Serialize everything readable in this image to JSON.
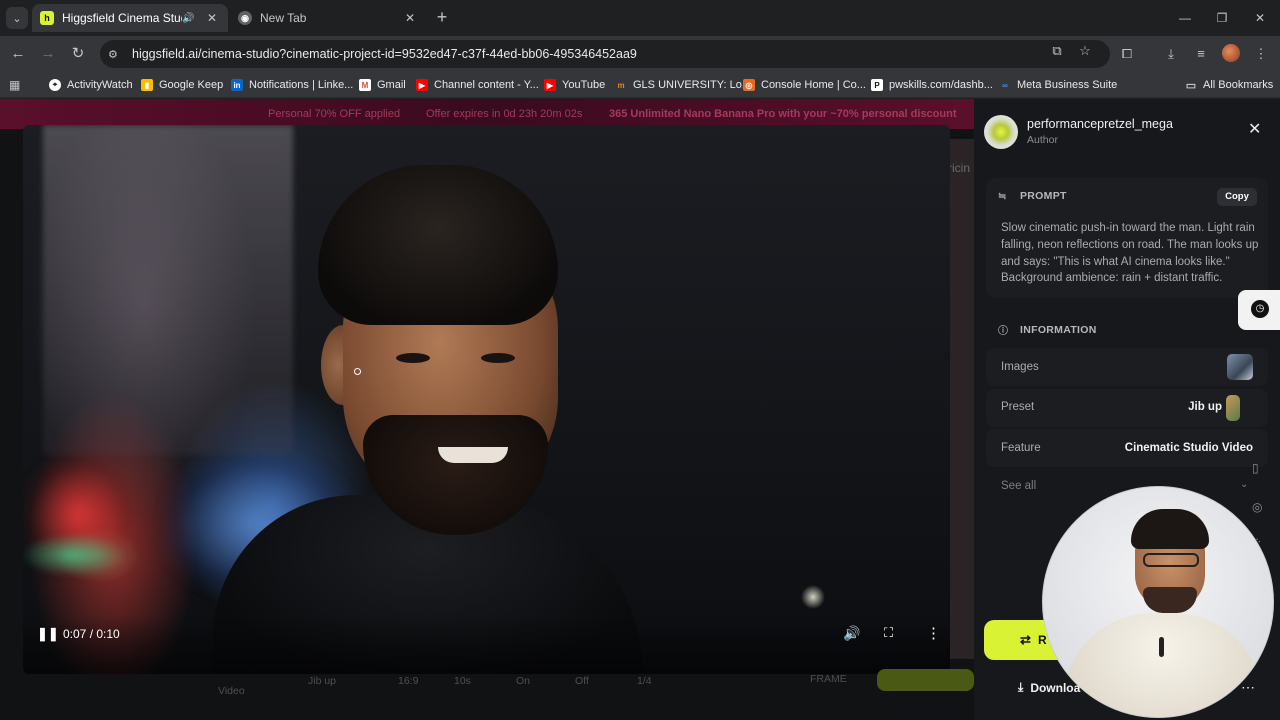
{
  "browser": {
    "tabs": [
      {
        "title": "Higgsfield Cinema Studio | ",
        "active": true
      },
      {
        "title": "New Tab",
        "active": false
      }
    ],
    "url": "higgsfield.ai/cinema-studio?cinematic-project-id=9532ed47-c37f-44ed-bb06-495346452aa9",
    "bookmarks": [
      "ActivityWatch",
      "Google Keep",
      "Notifications | Linke...",
      "Gmail",
      "Channel content - Y...",
      "YouTube",
      "GLS UNIVERSITY: Lo...",
      "Console Home | Co...",
      "pwskills.com/dashb...",
      "Meta Business Suite"
    ],
    "all_bookmarks_label": "All Bookmarks"
  },
  "promo": {
    "left": "Personal 70% OFF applied",
    "middle": "Offer expires in 0d 23h 20m 02s",
    "right": "365 Unlimited Nano Banana Pro with your ~70% personal discount"
  },
  "background": {
    "pricing_fragment": "ricin"
  },
  "video": {
    "time": "0:07 / 0:10",
    "progress": 0.75
  },
  "composer": {
    "video_label": "Video",
    "preset": "Jib up",
    "aspect": "16:9",
    "duration": "10s",
    "sound": "On",
    "other": "Off",
    "count": "1/4",
    "frame": "FRAME"
  },
  "panel": {
    "author_name": "performancepretzel_mega",
    "author_role": "Author",
    "prompt_heading": "PROMPT",
    "copy_label": "Copy",
    "prompt_text": "Slow cinematic push-in toward the man. Light rain falling, neon reflections on road. The man looks up and says: \"This is what AI cinema looks like.\" Background ambience: rain + distant traffic.",
    "info_heading": "INFORMATION",
    "info": [
      {
        "label": "Images",
        "value": ""
      },
      {
        "label": "Preset",
        "value": "Jib up"
      },
      {
        "label": "Feature",
        "value": "Cinematic Studio Video"
      }
    ],
    "see_all": "See all",
    "regenerate_label": "R",
    "download_label": "Downloa"
  }
}
